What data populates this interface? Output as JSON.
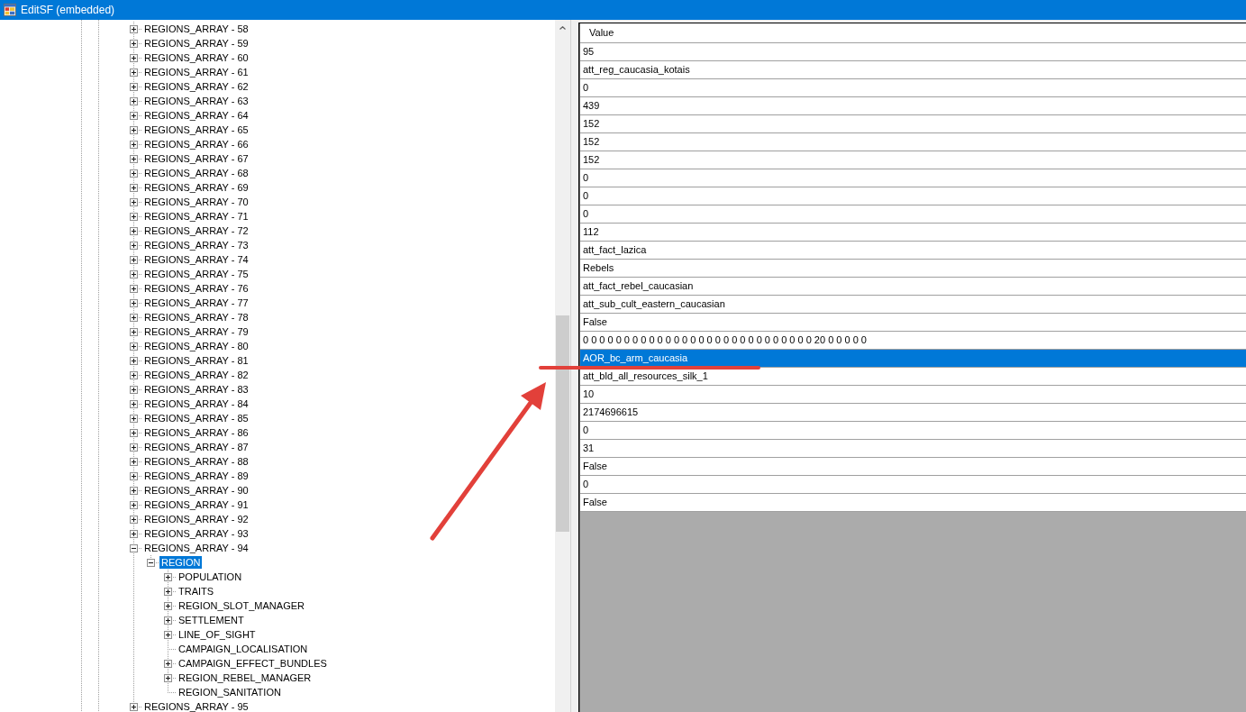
{
  "window": {
    "title": "EditSF (embedded)"
  },
  "tree": {
    "items": [
      {
        "label": "REGIONS_ARRAY - 58",
        "kind": "branch",
        "expanded": false,
        "selected": false
      },
      {
        "label": "REGIONS_ARRAY - 59",
        "kind": "branch",
        "expanded": false,
        "selected": false
      },
      {
        "label": "REGIONS_ARRAY - 60",
        "kind": "branch",
        "expanded": false,
        "selected": false
      },
      {
        "label": "REGIONS_ARRAY - 61",
        "kind": "branch",
        "expanded": false,
        "selected": false
      },
      {
        "label": "REGIONS_ARRAY - 62",
        "kind": "branch",
        "expanded": false,
        "selected": false
      },
      {
        "label": "REGIONS_ARRAY - 63",
        "kind": "branch",
        "expanded": false,
        "selected": false
      },
      {
        "label": "REGIONS_ARRAY - 64",
        "kind": "branch",
        "expanded": false,
        "selected": false
      },
      {
        "label": "REGIONS_ARRAY - 65",
        "kind": "branch",
        "expanded": false,
        "selected": false
      },
      {
        "label": "REGIONS_ARRAY - 66",
        "kind": "branch",
        "expanded": false,
        "selected": false
      },
      {
        "label": "REGIONS_ARRAY - 67",
        "kind": "branch",
        "expanded": false,
        "selected": false
      },
      {
        "label": "REGIONS_ARRAY - 68",
        "kind": "branch",
        "expanded": false,
        "selected": false
      },
      {
        "label": "REGIONS_ARRAY - 69",
        "kind": "branch",
        "expanded": false,
        "selected": false
      },
      {
        "label": "REGIONS_ARRAY - 70",
        "kind": "branch",
        "expanded": false,
        "selected": false
      },
      {
        "label": "REGIONS_ARRAY - 71",
        "kind": "branch",
        "expanded": false,
        "selected": false
      },
      {
        "label": "REGIONS_ARRAY - 72",
        "kind": "branch",
        "expanded": false,
        "selected": false
      },
      {
        "label": "REGIONS_ARRAY - 73",
        "kind": "branch",
        "expanded": false,
        "selected": false
      },
      {
        "label": "REGIONS_ARRAY - 74",
        "kind": "branch",
        "expanded": false,
        "selected": false
      },
      {
        "label": "REGIONS_ARRAY - 75",
        "kind": "branch",
        "expanded": false,
        "selected": false
      },
      {
        "label": "REGIONS_ARRAY - 76",
        "kind": "branch",
        "expanded": false,
        "selected": false
      },
      {
        "label": "REGIONS_ARRAY - 77",
        "kind": "branch",
        "expanded": false,
        "selected": false
      },
      {
        "label": "REGIONS_ARRAY - 78",
        "kind": "branch",
        "expanded": false,
        "selected": false
      },
      {
        "label": "REGIONS_ARRAY - 79",
        "kind": "branch",
        "expanded": false,
        "selected": false
      },
      {
        "label": "REGIONS_ARRAY - 80",
        "kind": "branch",
        "expanded": false,
        "selected": false
      },
      {
        "label": "REGIONS_ARRAY - 81",
        "kind": "branch",
        "expanded": false,
        "selected": false
      },
      {
        "label": "REGIONS_ARRAY - 82",
        "kind": "branch",
        "expanded": false,
        "selected": false
      },
      {
        "label": "REGIONS_ARRAY - 83",
        "kind": "branch",
        "expanded": false,
        "selected": false
      },
      {
        "label": "REGIONS_ARRAY - 84",
        "kind": "branch",
        "expanded": false,
        "selected": false
      },
      {
        "label": "REGIONS_ARRAY - 85",
        "kind": "branch",
        "expanded": false,
        "selected": false
      },
      {
        "label": "REGIONS_ARRAY - 86",
        "kind": "branch",
        "expanded": false,
        "selected": false
      },
      {
        "label": "REGIONS_ARRAY - 87",
        "kind": "branch",
        "expanded": false,
        "selected": false
      },
      {
        "label": "REGIONS_ARRAY - 88",
        "kind": "branch",
        "expanded": false,
        "selected": false
      },
      {
        "label": "REGIONS_ARRAY - 89",
        "kind": "branch",
        "expanded": false,
        "selected": false
      },
      {
        "label": "REGIONS_ARRAY - 90",
        "kind": "branch",
        "expanded": false,
        "selected": false
      },
      {
        "label": "REGIONS_ARRAY - 91",
        "kind": "branch",
        "expanded": false,
        "selected": false
      },
      {
        "label": "REGIONS_ARRAY - 92",
        "kind": "branch",
        "expanded": false,
        "selected": false
      },
      {
        "label": "REGIONS_ARRAY - 93",
        "kind": "branch",
        "expanded": false,
        "selected": false
      },
      {
        "label": "REGIONS_ARRAY - 94",
        "kind": "branch",
        "expanded": true,
        "selected": false,
        "children": [
          {
            "label": "REGION",
            "kind": "branch",
            "expanded": true,
            "selected": true,
            "children": [
              {
                "label": "POPULATION",
                "kind": "branch",
                "expanded": false,
                "selected": false
              },
              {
                "label": "TRAITS",
                "kind": "branch",
                "expanded": false,
                "selected": false
              },
              {
                "label": "REGION_SLOT_MANAGER",
                "kind": "branch",
                "expanded": false,
                "selected": false
              },
              {
                "label": "SETTLEMENT",
                "kind": "branch",
                "expanded": false,
                "selected": false
              },
              {
                "label": "LINE_OF_SIGHT",
                "kind": "branch",
                "expanded": false,
                "selected": false
              },
              {
                "label": "CAMPAIGN_LOCALISATION",
                "kind": "leaf",
                "selected": false
              },
              {
                "label": "CAMPAIGN_EFFECT_BUNDLES",
                "kind": "branch",
                "expanded": false,
                "selected": false
              },
              {
                "label": "REGION_REBEL_MANAGER",
                "kind": "branch",
                "expanded": false,
                "selected": false
              },
              {
                "label": "REGION_SANITATION",
                "kind": "leaf",
                "selected": false
              }
            ]
          }
        ]
      },
      {
        "label": "REGIONS_ARRAY - 95",
        "kind": "branch",
        "expanded": false,
        "selected": false
      }
    ]
  },
  "grid": {
    "header": "Value",
    "rows": [
      {
        "value": "95",
        "selected": false
      },
      {
        "value": "att_reg_caucasia_kotais",
        "selected": false
      },
      {
        "value": "0",
        "selected": false
      },
      {
        "value": "439",
        "selected": false
      },
      {
        "value": "152",
        "selected": false
      },
      {
        "value": "152",
        "selected": false
      },
      {
        "value": "152",
        "selected": false
      },
      {
        "value": "0",
        "selected": false
      },
      {
        "value": "0",
        "selected": false
      },
      {
        "value": "0",
        "selected": false
      },
      {
        "value": "112",
        "selected": false
      },
      {
        "value": "att_fact_lazica",
        "selected": false
      },
      {
        "value": "Rebels",
        "selected": false
      },
      {
        "value": "att_fact_rebel_caucasian",
        "selected": false
      },
      {
        "value": "att_sub_cult_eastern_caucasian",
        "selected": false
      },
      {
        "value": "False",
        "selected": false
      },
      {
        "value": "0 0 0 0 0 0 0 0 0 0 0 0 0 0 0 0 0 0 0 0 0 0 0 0 0 0 0 0 20 0 0 0 0 0",
        "selected": false
      },
      {
        "value": "AOR_bc_arm_caucasia",
        "selected": true
      },
      {
        "value": "att_bld_all_resources_silk_1",
        "selected": false
      },
      {
        "value": "10",
        "selected": false
      },
      {
        "value": "2174696615",
        "selected": false
      },
      {
        "value": "0",
        "selected": false
      },
      {
        "value": "31",
        "selected": false
      },
      {
        "value": "False",
        "selected": false
      },
      {
        "value": "0",
        "selected": false
      },
      {
        "value": "False",
        "selected": false
      }
    ]
  }
}
